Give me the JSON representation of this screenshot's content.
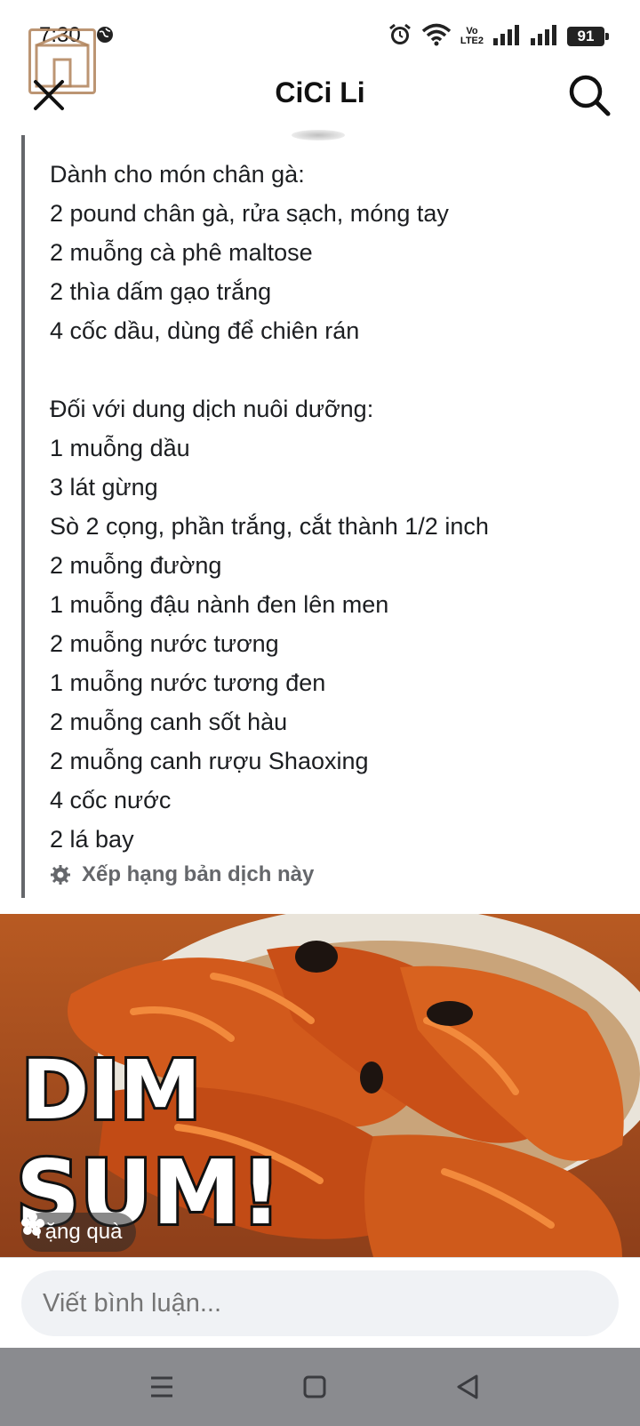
{
  "status_bar": {
    "time": "7:30",
    "lte": [
      "Vo",
      "LTE2"
    ],
    "battery": "91"
  },
  "header": {
    "title": "CiCi Li",
    "close_icon": "close-icon",
    "search_icon": "search-icon"
  },
  "post": {
    "lines": [
      "Dành cho món chân gà:",
      "2 pound chân gà, rửa sạch, móng tay",
      "2 muỗng cà phê maltose",
      "2 thìa dấm gạo trắng",
      "4 cốc dầu, dùng để chiên rán",
      "",
      "Đối với dung dịch nuôi dưỡng:",
      "1 muỗng dầu",
      "3 lát gừng",
      "Sò 2 cọng, phần trắng, cắt thành 1/2 inch",
      "2 muỗng đường",
      "1 muỗng đậu nành đen lên men",
      "2 muỗng nước tương",
      "1 muỗng nước tương đen",
      "2 muỗng canh sốt hàu",
      "2 muỗng canh rượu Shaoxing",
      "4 cốc nước",
      "2 lá bay"
    ],
    "rate_translation": "Xếp hạng bản dịch này"
  },
  "photo": {
    "overlay_text": [
      "DIM",
      "SUM!"
    ],
    "gift_label": "Tặng quà"
  },
  "comment": {
    "placeholder": "Viết bình luận..."
  },
  "colors": {
    "accent_gray": "#65676b",
    "navbar": "#8a8b8f",
    "input_bg": "#f0f2f5"
  }
}
